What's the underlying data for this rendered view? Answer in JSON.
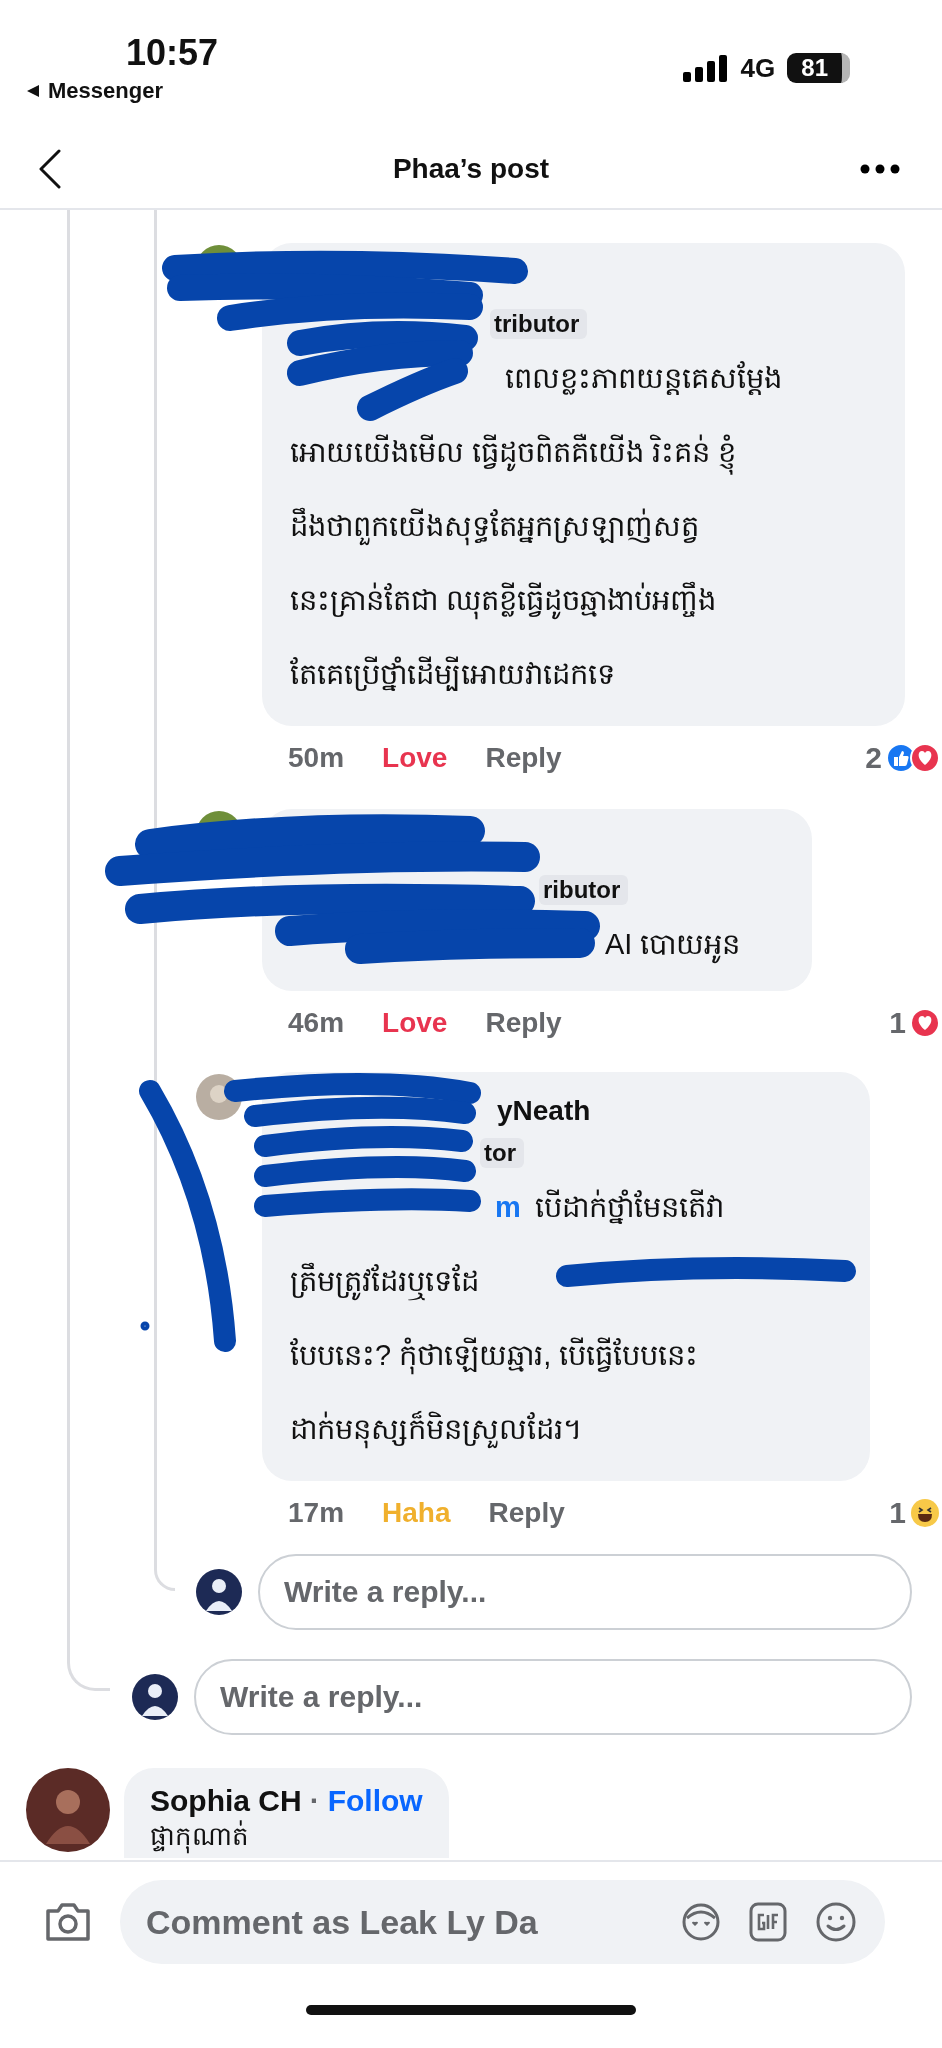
{
  "status_bar": {
    "time": "10:57",
    "back_app": "Messenger",
    "network": "4G",
    "battery": "81"
  },
  "header": {
    "title": "Phaa’s post"
  },
  "comments": [
    {
      "badge": "tributor",
      "lines": [
        "ពេលខ្លះភាពយន្តគេសម្តែង",
        "អោយយើងមើល ធ្វើដូចពិតគឺយើង រិះគន់ ខ្ញុំ",
        "ដឹងថាពួកយើងសុទ្ធតែអ្នកស្រឡាញ់សត្វ",
        "នេះគ្រាន់តែជា ឈុតខ្លីធ្វើដូចឆ្មាងាប់អញ្ចឹង",
        "តែគេប្រើថ្នាំដើម្បីអោយវាដេកទេ"
      ],
      "time": "50m",
      "reaction": {
        "label": "Love",
        "color": "#e8344f"
      },
      "reply": "Reply",
      "count": "2",
      "icons": [
        {
          "kind": "like"
        },
        {
          "kind": "love"
        }
      ]
    },
    {
      "badge": "ributor",
      "lines": [
        "AI បោយអូន"
      ],
      "time": "46m",
      "reaction": {
        "label": "Love",
        "color": "#e8344f"
      },
      "reply": "Reply",
      "count": "1",
      "icons": [
        {
          "kind": "love"
        }
      ]
    },
    {
      "name": "yNeath",
      "badge": "tor",
      "mention": "m",
      "lines": [
        "បើដាក់ថ្នាំមែនតើវា",
        "ត្រឹមត្រូវដែរឬទេដែ",
        "បែបនេះ? កុំថាឡើយឆ្មារ, បើធ្វើបែបនេះ",
        "ដាក់មនុស្សក៏មិនស្រួលដែរ។"
      ],
      "time": "17m",
      "reaction": {
        "label": "Haha",
        "color": "#f0b02d"
      },
      "reply": "Reply",
      "count": "1",
      "icons": [
        {
          "kind": "haha"
        }
      ]
    }
  ],
  "reply_fields": [
    {
      "placeholder": "Write a reply..."
    },
    {
      "placeholder": "Write a reply..."
    }
  ],
  "next_comment": {
    "name": "Sophia CH",
    "separator": "·",
    "follow": "Follow",
    "text": "ផ្ទាកុណាត់"
  },
  "composer": {
    "placeholder": "Comment as Leak Ly Da"
  }
}
